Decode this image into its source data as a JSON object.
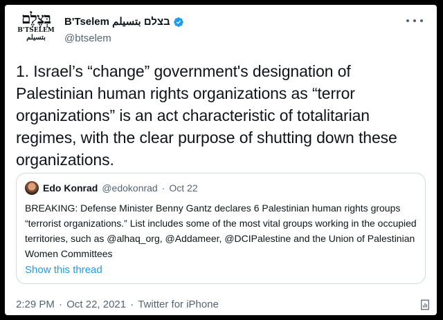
{
  "account": {
    "avatar": {
      "logo_hebrew": "בְּצֶלֶם",
      "logo_latin": "B'TSELEM",
      "logo_arabic": "بتسيلم"
    },
    "display_name": "B'Tselem בצלם بتسيلم",
    "handle": "@btselem",
    "verified": true
  },
  "tweet": {
    "text": "1. Israel’s “change” government's designation of Palestinian human rights organizations as “terror organizations” is an act characteristic of totalitarian regimes, with the clear purpose of shutting down these organizations."
  },
  "quoted_tweet": {
    "author_name": "Edo Konrad",
    "author_handle": "@edokonrad",
    "separator": "·",
    "date": "Oct 22",
    "text": "BREAKING: Defense Minister Benny Gantz declares 6 Palestinian human rights groups “terrorist organizations.” List includes some of the most vital groups working in the occupied territories, such as @alhaq_org, @Addameer, @DCIPalestine and the Union of Palestinian Women Committees",
    "show_thread_label": "Show this thread"
  },
  "meta": {
    "time": "2:29 PM",
    "separator": "·",
    "date": "Oct 22, 2021",
    "source": "Twitter for iPhone"
  },
  "colors": {
    "link": "#1d9bf0",
    "secondary_text": "#536471",
    "border": "#cfd9de",
    "outer_background": "#000000"
  }
}
